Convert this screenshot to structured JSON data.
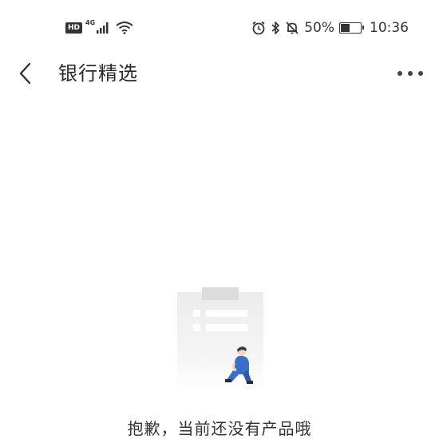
{
  "status_bar": {
    "hd": "HD",
    "network": "4G",
    "battery_percent": "50%",
    "battery_level": 0.5,
    "time": "10:36",
    "icons": [
      "signal-icon",
      "wifi-icon",
      "alarm-icon",
      "bluetooth-icon",
      "mute-icon",
      "battery-icon"
    ]
  },
  "header": {
    "title": "银行精选",
    "back_icon": "chevron-left-icon",
    "more_icon": "more-dots-icon"
  },
  "empty_state": {
    "message": "抱歉，当前还没有产品哦",
    "illustration": "empty-clipboard-illustration"
  },
  "colors": {
    "background": "#ffffff",
    "text_primary": "#2a2a2a",
    "illustration_blue": "#3a6fc4"
  }
}
